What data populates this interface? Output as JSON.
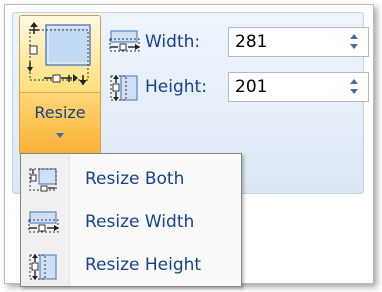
{
  "resize_button": {
    "label": "Resize",
    "icon": "resize-image-icon"
  },
  "fields": [
    {
      "label": "Width:",
      "value": "281",
      "icon": "resize-width-icon"
    },
    {
      "label": "Height:",
      "value": "201",
      "icon": "resize-height-icon"
    }
  ],
  "menu": {
    "items": [
      {
        "label": "Resize Both",
        "icon": "resize-both-icon"
      },
      {
        "label": "Resize Width",
        "icon": "resize-width-icon"
      },
      {
        "label": "Resize Height",
        "icon": "resize-height-icon"
      }
    ]
  },
  "colors": {
    "label_text": "#15428b",
    "button_highlight": "#ffe07e",
    "button_pressed": "#fbc04b",
    "ribbon_background": "#e3ecf8"
  }
}
